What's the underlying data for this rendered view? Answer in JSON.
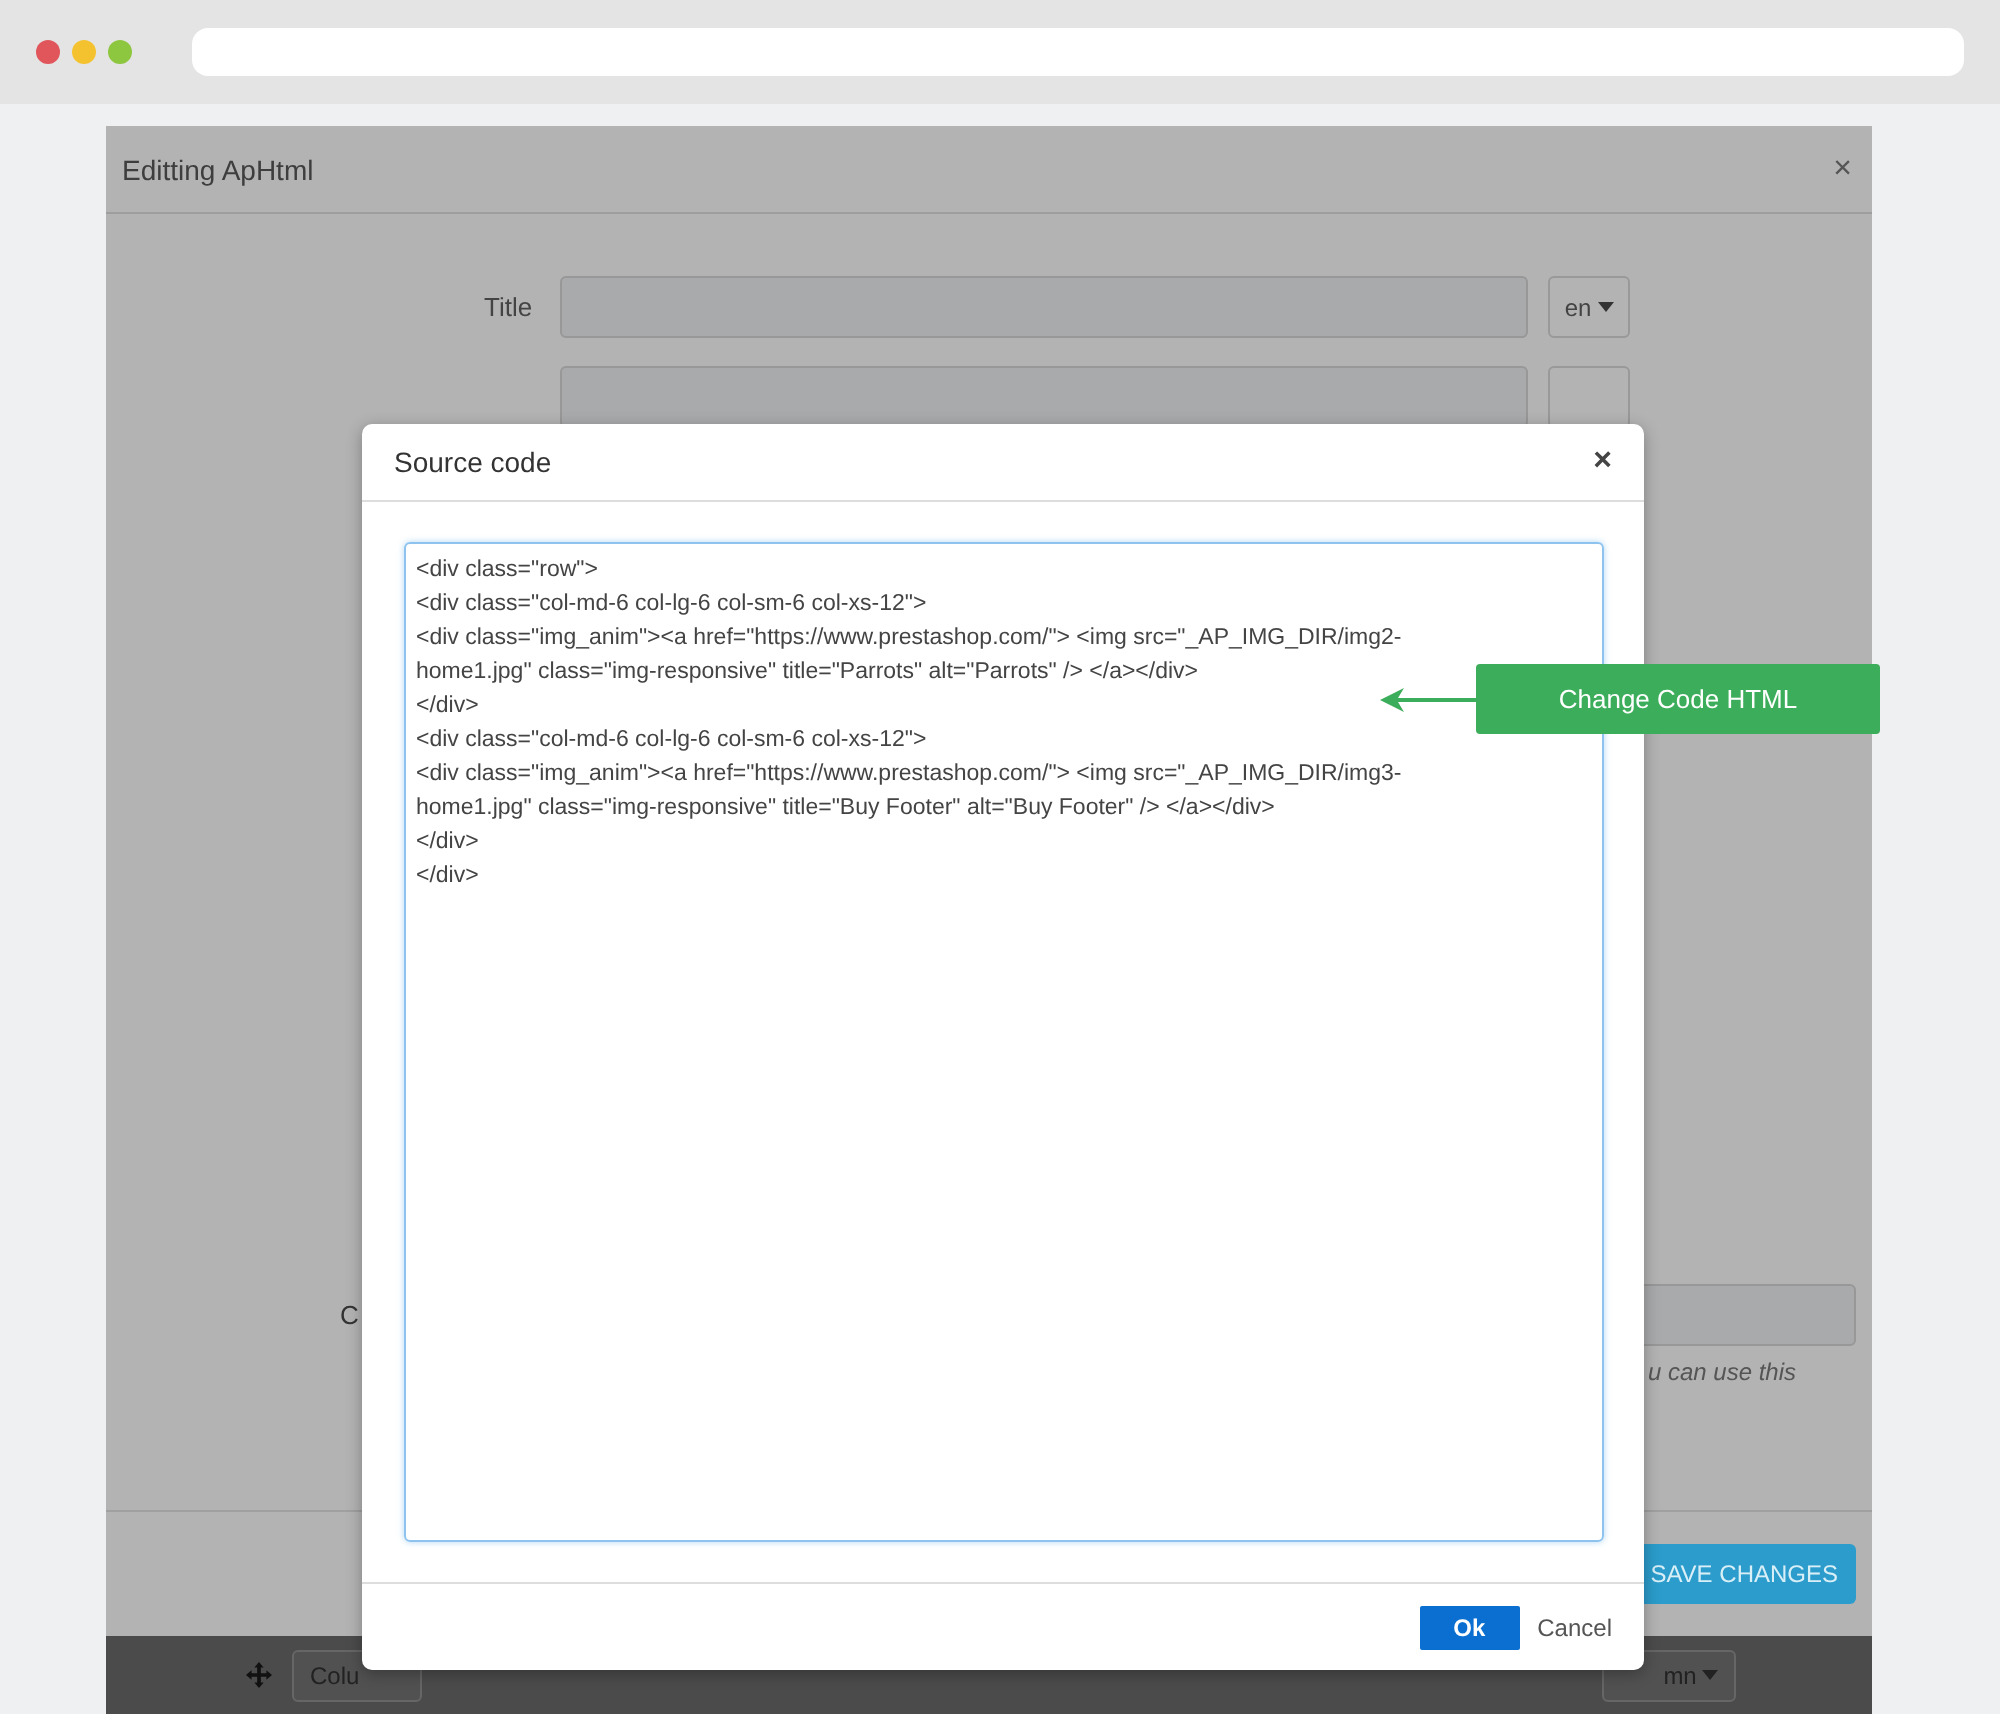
{
  "back_modal": {
    "title": "Editting ApHtml",
    "close": "×",
    "title_field": {
      "label": "Title",
      "lang": "en"
    },
    "cut_label": "C",
    "hint": "u can use this",
    "save_button": "SAVE CHANGES"
  },
  "bottom_strip": {
    "left_select": "Colu",
    "right_select": "mn"
  },
  "dialog": {
    "title": "Source code",
    "close": "×",
    "code_lines": [
      "<div class=\"row\">",
      "<div class=\"col-md-6 col-lg-6 col-sm-6 col-xs-12\">",
      "<div class=\"img_anim\"><a href=\"https://www.prestashop.com/\"> <img src=\"_AP_IMG_DIR/img2-",
      "home1.jpg\" class=\"img-responsive\" title=\"Parrots\" alt=\"Parrots\" /> </a></div>",
      "</div>",
      "<div class=\"col-md-6 col-lg-6 col-sm-6 col-xs-12\">",
      "<div class=\"img_anim\"><a href=\"https://www.prestashop.com/\"> <img src=\"_AP_IMG_DIR/img3-",
      "home1.jpg\" class=\"img-responsive\" title=\"Buy Footer\" alt=\"Buy Footer\" /> </a></div>",
      "</div>",
      "</div>"
    ],
    "ok_button": "Ok",
    "cancel_button": "Cancel"
  },
  "callout": {
    "text": "Change Code HTML"
  }
}
